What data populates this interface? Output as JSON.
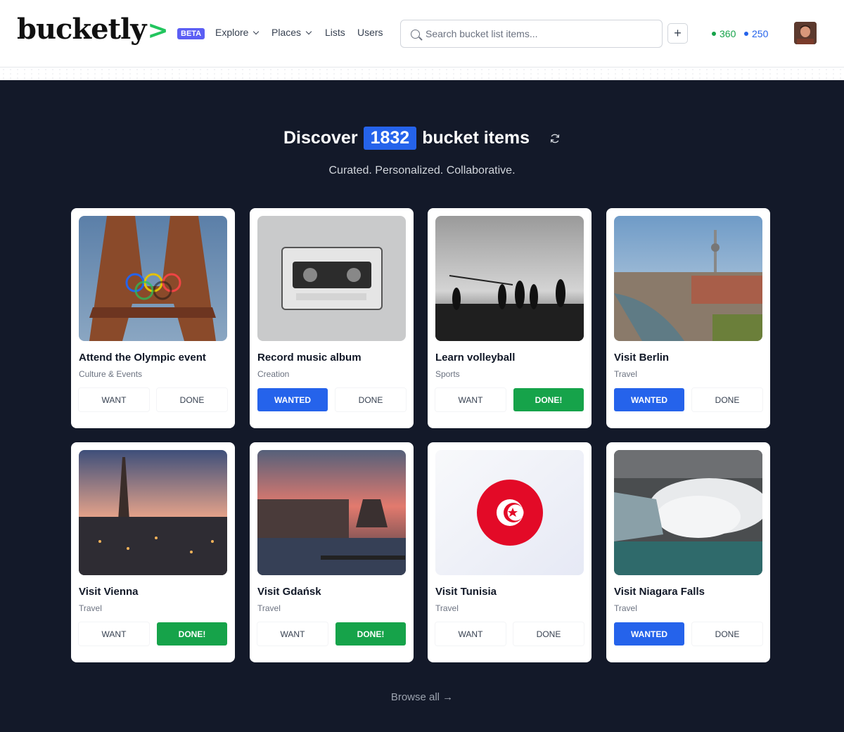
{
  "header": {
    "logo_text": "bucketly",
    "logo_arrow": ">",
    "beta_badge": "BETA",
    "nav": {
      "explore": "Explore",
      "places": "Places",
      "lists": "Lists",
      "users": "Users"
    },
    "search_placeholder": "Search bucket list items...",
    "add_label": "+",
    "stat_green": "360",
    "stat_blue": "250",
    "colors": {
      "green": "#16a34a",
      "blue": "#2563eb"
    }
  },
  "hero": {
    "title_prefix": "Discover",
    "count": "1832",
    "title_suffix": "bucket items",
    "subtitle": "Curated. Personalized. Collaborative."
  },
  "cards": [
    {
      "title": "Attend the Olympic event",
      "category": "Culture & Events",
      "want_label": "WANT",
      "done_label": "DONE",
      "want_state": "default",
      "done_state": "default",
      "image": "eiffel-tower-olympic-rings"
    },
    {
      "title": "Record music album",
      "category": "Creation",
      "want_label": "WANTED",
      "done_label": "DONE",
      "want_state": "active",
      "done_state": "default",
      "image": "cassette-tape"
    },
    {
      "title": "Learn volleyball",
      "category": "Sports",
      "want_label": "WANT",
      "done_label": "DONE!",
      "want_state": "default",
      "done_state": "active",
      "image": "beach-volleyball-silhouettes"
    },
    {
      "title": "Visit Berlin",
      "category": "Travel",
      "want_label": "WANTED",
      "done_label": "DONE",
      "want_state": "active",
      "done_state": "default",
      "image": "berlin-skyline"
    },
    {
      "title": "Visit Vienna",
      "category": "Travel",
      "want_label": "WANT",
      "done_label": "DONE!",
      "want_state": "default",
      "done_state": "active",
      "image": "vienna-cathedral-dusk"
    },
    {
      "title": "Visit Gdańsk",
      "category": "Travel",
      "want_label": "WANT",
      "done_label": "DONE!",
      "want_state": "default",
      "done_state": "active",
      "image": "gdansk-waterfront-sunset"
    },
    {
      "title": "Visit Tunisia",
      "category": "Travel",
      "want_label": "WANT",
      "done_label": "DONE",
      "want_state": "default",
      "done_state": "default",
      "image": "tunisia-flag"
    },
    {
      "title": "Visit Niagara Falls",
      "category": "Travel",
      "want_label": "WANTED",
      "done_label": "DONE",
      "want_state": "active",
      "done_state": "default",
      "image": "niagara-falls"
    }
  ],
  "footer": {
    "browse_all": "Browse all →"
  }
}
